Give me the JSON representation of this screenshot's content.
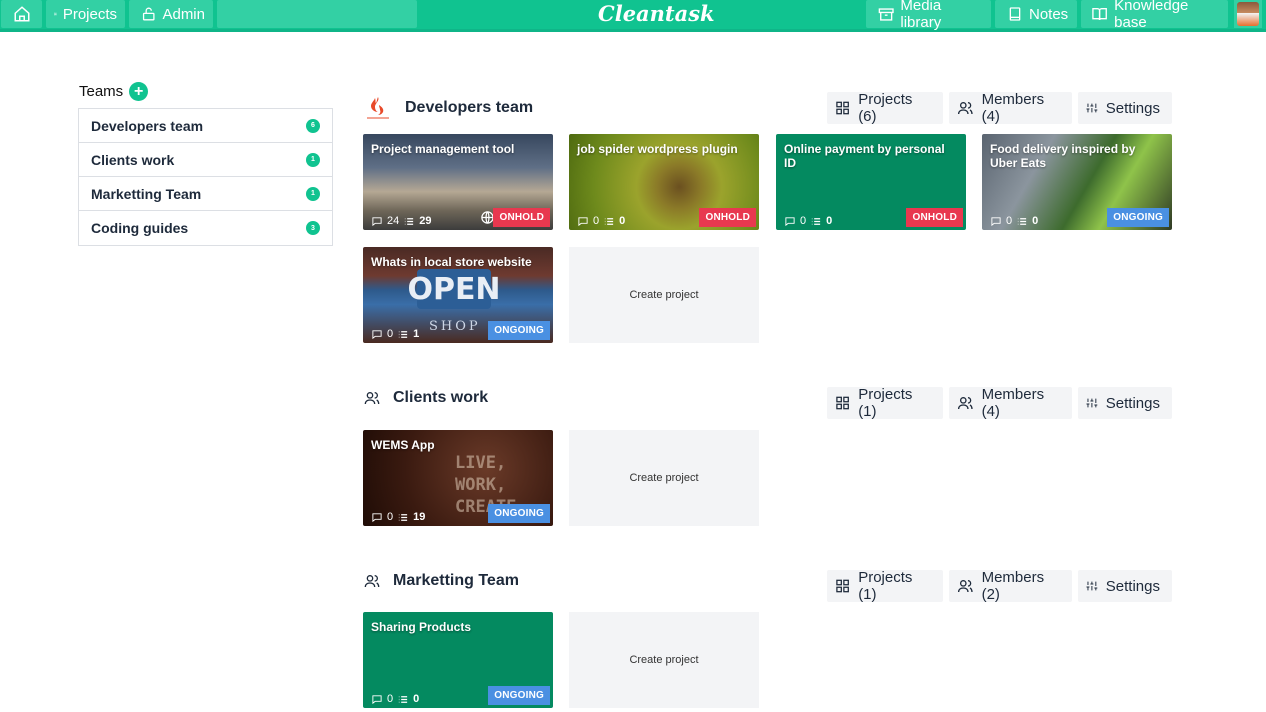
{
  "topbar": {
    "brand": "Cleantask",
    "projects": "Projects",
    "admin": "Admin",
    "media_library": "Media library",
    "notes": "Notes",
    "knowledge_base": "Knowledge base"
  },
  "sidebar": {
    "title": "Teams",
    "items": [
      {
        "label": "Developers team",
        "count": "6"
      },
      {
        "label": "Clients work",
        "count": "1"
      },
      {
        "label": "Marketting Team",
        "count": "1"
      },
      {
        "label": "Coding guides",
        "count": "3"
      }
    ]
  },
  "sections": [
    {
      "title": "Developers team",
      "projects_btn": "Projects (6)",
      "members_btn": "Members (4)",
      "settings_btn": "Settings",
      "cards": [
        {
          "title": "Project management tool",
          "comments": "24",
          "tasks": "29",
          "status": "ONHOLD"
        },
        {
          "title": "job spider wordpress plugin",
          "comments": "0",
          "tasks": "0",
          "status": "ONHOLD"
        },
        {
          "title": "Online payment by personal ID",
          "comments": "0",
          "tasks": "0",
          "status": "ONHOLD"
        },
        {
          "title": "Food delivery inspired by Uber Eats",
          "comments": "0",
          "tasks": "0",
          "status": "ONGOING"
        },
        {
          "title": "Whats in local store website",
          "comments": "0",
          "tasks": "1",
          "status": "ONGOING"
        }
      ],
      "create_label": "Create project"
    },
    {
      "title": "Clients work",
      "projects_btn": "Projects (1)",
      "members_btn": "Members (4)",
      "settings_btn": "Settings",
      "cards": [
        {
          "title": "WEMS App",
          "comments": "0",
          "tasks": "19",
          "status": "ONGOING"
        }
      ],
      "create_label": "Create project"
    },
    {
      "title": "Marketting Team",
      "projects_btn": "Projects (1)",
      "members_btn": "Members (2)",
      "settings_btn": "Settings",
      "cards": [
        {
          "title": "Sharing Products",
          "comments": "0",
          "tasks": "0",
          "status": "ONGOING"
        }
      ],
      "create_label": "Create project"
    }
  ],
  "colors": {
    "accent": "#10c390",
    "onhold": "#e8384f",
    "ongoing": "#4a90e2",
    "card_green": "#048a60"
  }
}
